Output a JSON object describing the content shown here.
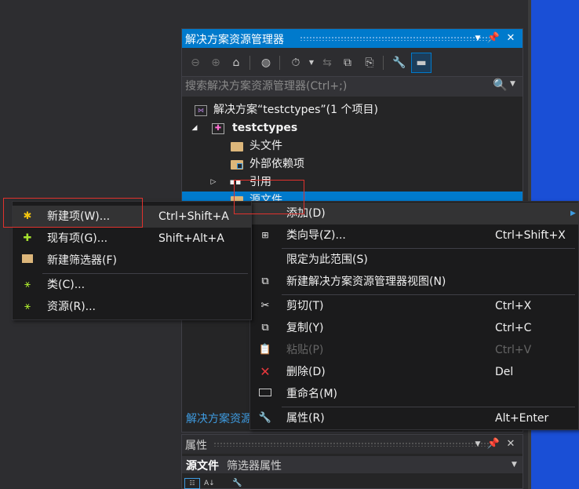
{
  "solution_explorer": {
    "title": "解决方案资源管理器",
    "search_placeholder": "搜索解决方案资源管理器(Ctrl+;)",
    "tree": [
      {
        "label": "解决方案“testctypes”(1 个项目)"
      },
      {
        "label": "testctypes"
      },
      {
        "label": "头文件"
      },
      {
        "label": "外部依赖项"
      },
      {
        "label": "引用"
      },
      {
        "label": "源文件"
      }
    ],
    "bottom_tab": "解决方案资源"
  },
  "properties": {
    "title": "属性",
    "object_name": "源文件",
    "object_desc": "筛选器属性"
  },
  "add_submenu": {
    "items": [
      {
        "label": "新建项(W)...",
        "shortcut": "Ctrl+Shift+A"
      },
      {
        "label": "现有项(G)...",
        "shortcut": "Shift+Alt+A"
      },
      {
        "label": "新建筛选器(F)",
        "shortcut": ""
      },
      {
        "label": "类(C)...",
        "shortcut": ""
      },
      {
        "label": "资源(R)...",
        "shortcut": ""
      }
    ]
  },
  "context_menu": {
    "items": [
      {
        "label": "添加(D)",
        "shortcut": ""
      },
      {
        "label": "类向导(Z)...",
        "shortcut": "Ctrl+Shift+X"
      },
      {
        "label": "限定为此范围(S)",
        "shortcut": ""
      },
      {
        "label": "新建解决方案资源管理器视图(N)",
        "shortcut": ""
      },
      {
        "label": "剪切(T)",
        "shortcut": "Ctrl+X"
      },
      {
        "label": "复制(Y)",
        "shortcut": "Ctrl+C"
      },
      {
        "label": "粘贴(P)",
        "shortcut": "Ctrl+V"
      },
      {
        "label": "删除(D)",
        "shortcut": "Del"
      },
      {
        "label": "重命名(M)",
        "shortcut": ""
      },
      {
        "label": "属性(R)",
        "shortcut": "Alt+Enter"
      }
    ]
  },
  "colors": {
    "accent": "#007acc",
    "highlight_box": "#e0322d",
    "desktop": "#1a4fd6"
  }
}
